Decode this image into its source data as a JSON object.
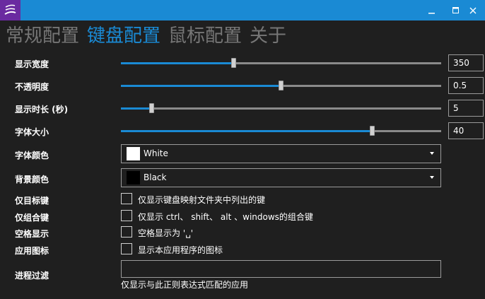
{
  "titlebar": {
    "icons": [
      "app-icon",
      "minimize-icon",
      "maximize-icon",
      "close-icon"
    ],
    "accent": "#1a8ad4",
    "app_icon_bg": "#6a2aa0"
  },
  "tabs": [
    {
      "label": "常规配置",
      "active": false
    },
    {
      "label": "键盘配置",
      "active": true
    },
    {
      "label": "鼠标配置",
      "active": false
    },
    {
      "label": "关于",
      "active": false
    }
  ],
  "sliders": [
    {
      "label": "显示宽度",
      "value": "350",
      "fraction": 0.35
    },
    {
      "label": "不透明度",
      "value": "0.5",
      "fraction": 0.5
    },
    {
      "label": "显示时长 (秒)",
      "value": "5",
      "fraction": 0.09
    },
    {
      "label": "字体大小",
      "value": "40",
      "fraction": 0.79
    }
  ],
  "combos": [
    {
      "label": "字体颜色",
      "value": "White",
      "swatch": "#ffffff"
    },
    {
      "label": "背景颜色",
      "value": "Black",
      "swatch": "#000000"
    }
  ],
  "checks": [
    {
      "label": "仅目标键",
      "text": "仅显示键盘映射文件夹中列出的键",
      "checked": false
    },
    {
      "label": "仅组合键",
      "text": "仅显示 ctrl、 shift、 alt 、windows的组合键",
      "checked": false
    },
    {
      "label": "空格显示",
      "text": "空格显示为 '␣'",
      "checked": false
    },
    {
      "label": "应用图标",
      "text": "显示本应用程序的图标",
      "checked": false
    }
  ],
  "process_filter": {
    "label": "进程过滤",
    "value": "",
    "hint": "仅显示与此正则表达式匹配的应用"
  }
}
